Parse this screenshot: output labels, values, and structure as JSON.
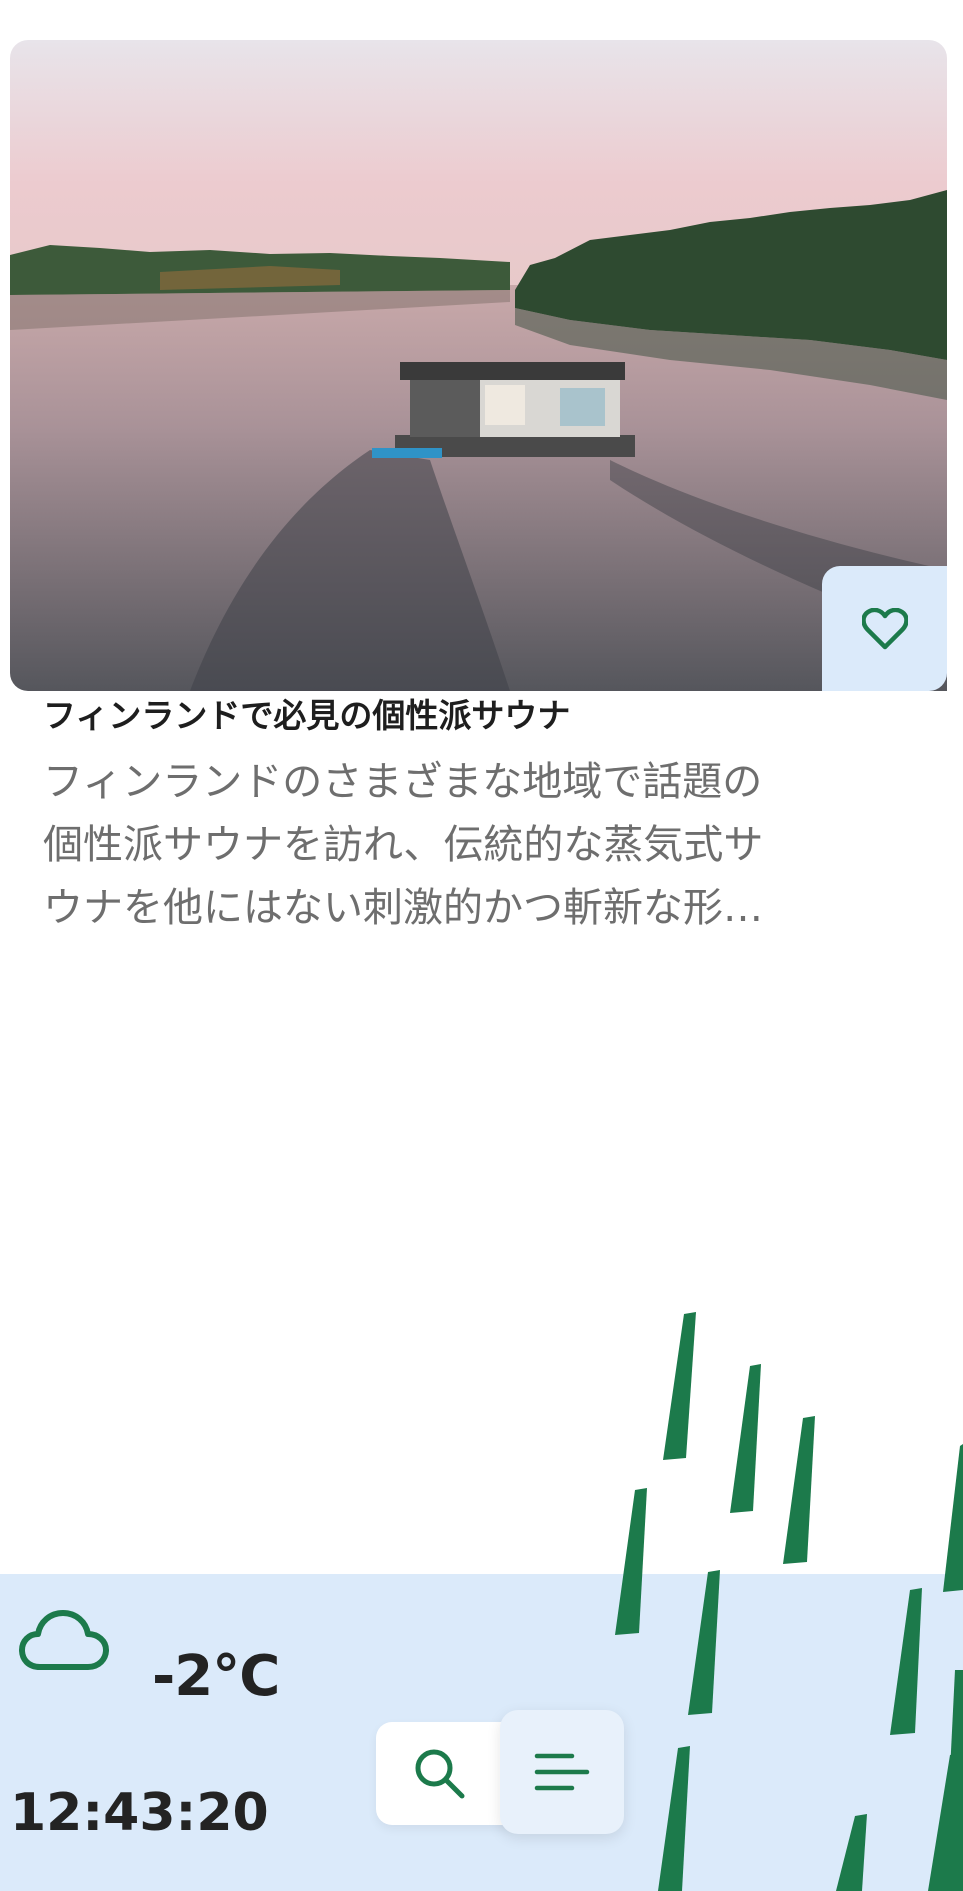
{
  "article": {
    "title": "フィンランドで必見の個性派サウナ",
    "description": "フィンランドのさまざまな地域で話題の個性派サウナを訪れ、伝統的な蒸気式サウナを他にはない刺激的かつ斬新な形で体験してみましょう。",
    "favorite_icon": "heart-icon"
  },
  "footer": {
    "weather_icon": "cloud-icon",
    "temperature": "-2°C",
    "time": "12:43:20",
    "search_icon": "search-icon",
    "menu_icon": "menu-icon"
  },
  "colors": {
    "brand_green": "#1c7a4b",
    "footer_background": "#dbeafa",
    "title_text": "#1e1e1e",
    "description_text": "#6e6e6e"
  }
}
